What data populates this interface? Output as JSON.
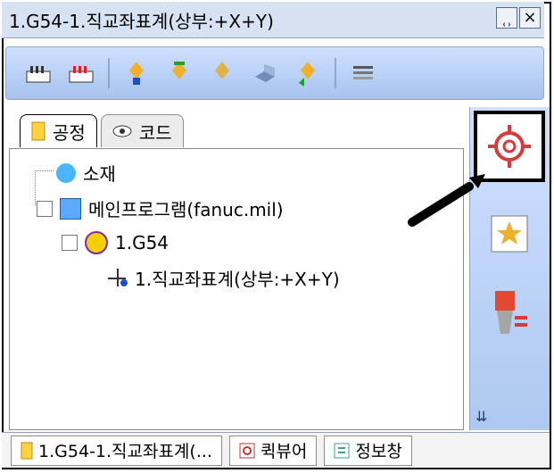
{
  "window": {
    "title": "1.G54-1.직교좌표계(상부:+X+Y)",
    "pin_label": "᪽",
    "close_label": "×"
  },
  "tabs": [
    {
      "label": "공정"
    },
    {
      "label": "코드"
    }
  ],
  "tree": {
    "n1": "소재",
    "n2": "메인프로그램(fanuc.mil)",
    "n3": "1.G54",
    "n4": "1.직교좌표계(상부:+X+Y)"
  },
  "bottom": {
    "t1": "1.G54-1.직교좌표계(...",
    "t2": "퀵뷰어",
    "t3": "정보창"
  },
  "icons": {
    "gear": "gear-icon",
    "wand": "magic-wand-icon",
    "tool": "tool-icon"
  }
}
